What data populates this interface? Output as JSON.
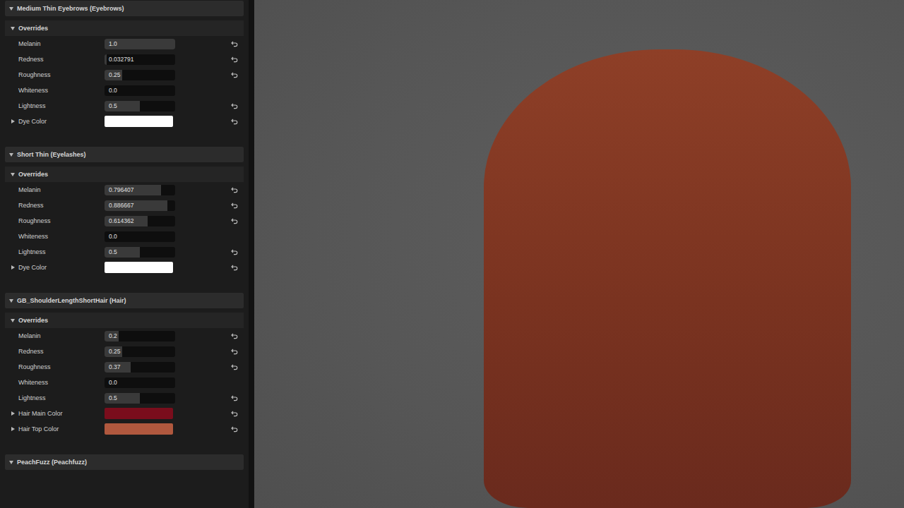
{
  "sections": [
    {
      "title": "Medium Thin Eyebrows (Eyebrows)",
      "expanded": true,
      "subsection": {
        "title": "Overrides",
        "expanded": true
      },
      "rows": [
        {
          "kind": "slider",
          "label": "Melanin",
          "value": "1.0",
          "level": 1.0,
          "resettable": true
        },
        {
          "kind": "slider",
          "label": "Redness",
          "value": "0.032791",
          "level": 0.032791,
          "resettable": true
        },
        {
          "kind": "slider",
          "label": "Roughness",
          "value": "0.25",
          "level": 0.25,
          "resettable": true
        },
        {
          "kind": "slider",
          "label": "Whiteness",
          "value": "0.0",
          "level": 0.0,
          "resettable": false
        },
        {
          "kind": "slider",
          "label": "Lightness",
          "value": "0.5",
          "level": 0.5,
          "resettable": true
        },
        {
          "kind": "color",
          "label": "Dye Color",
          "expanded": false,
          "color": "#ffffff",
          "resettable": true
        }
      ]
    },
    {
      "title": "Short Thin (Eyelashes)",
      "expanded": true,
      "subsection": {
        "title": "Overrides",
        "expanded": true
      },
      "rows": [
        {
          "kind": "slider",
          "label": "Melanin",
          "value": "0.796407",
          "level": 0.796407,
          "resettable": true
        },
        {
          "kind": "slider",
          "label": "Redness",
          "value": "0.886667",
          "level": 0.886667,
          "resettable": true
        },
        {
          "kind": "slider",
          "label": "Roughness",
          "value": "0.614362",
          "level": 0.614362,
          "resettable": true
        },
        {
          "kind": "slider",
          "label": "Whiteness",
          "value": "0.0",
          "level": 0.0,
          "resettable": false
        },
        {
          "kind": "slider",
          "label": "Lightness",
          "value": "0.5",
          "level": 0.5,
          "resettable": true
        },
        {
          "kind": "color",
          "label": "Dye Color",
          "expanded": false,
          "color": "#ffffff",
          "resettable": true
        }
      ]
    },
    {
      "title": "GB_ShoulderLengthShortHair (Hair)",
      "expanded": true,
      "subsection": {
        "title": "Overrides",
        "expanded": true
      },
      "rows": [
        {
          "kind": "slider",
          "label": "Melanin",
          "value": "0.2",
          "level": 0.2,
          "resettable": true
        },
        {
          "kind": "slider",
          "label": "Redness",
          "value": "0.25",
          "level": 0.25,
          "resettable": true
        },
        {
          "kind": "slider",
          "label": "Roughness",
          "value": "0.37",
          "level": 0.37,
          "resettable": true
        },
        {
          "kind": "slider",
          "label": "Whiteness",
          "value": "0.0",
          "level": 0.0,
          "resettable": false
        },
        {
          "kind": "slider",
          "label": "Lightness",
          "value": "0.5",
          "level": 0.5,
          "resettable": true
        },
        {
          "kind": "color",
          "label": "Hair Main Color",
          "expanded": false,
          "color": "#7a0d1c",
          "resettable": true
        },
        {
          "kind": "color",
          "label": "Hair Top Color",
          "expanded": false,
          "color": "#b0583e",
          "resettable": true
        }
      ]
    },
    {
      "title": "PeachFuzz (Peachfuzz)",
      "expanded": true,
      "subsection": null,
      "rows": []
    }
  ],
  "viewport": {
    "render": "character-render"
  }
}
